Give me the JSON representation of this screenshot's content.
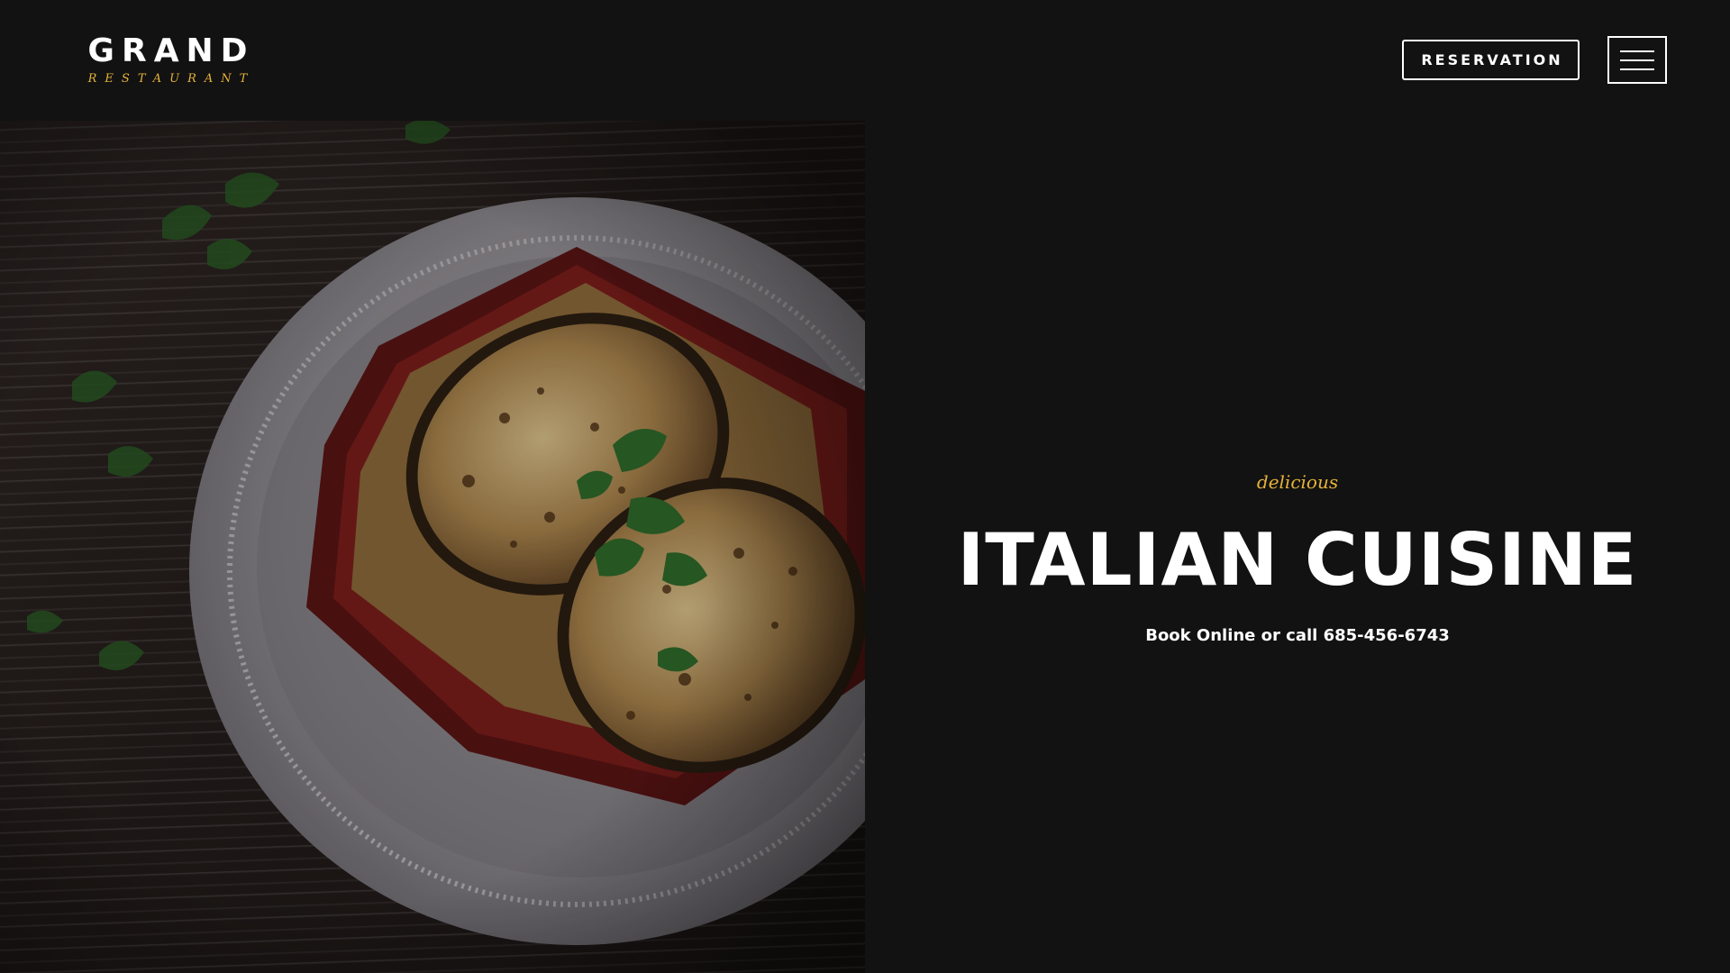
{
  "brand": {
    "name": "GRAND",
    "subtitle": "RESTAURANT"
  },
  "header": {
    "reservation_label": "RESERVATION",
    "menu_icon": "hamburger-menu-icon"
  },
  "hero": {
    "image_subject": "plated-lasagna-photo",
    "tagline": "delicious",
    "title": "ITALIAN CUISINE",
    "subtitle": "Book Online or call 685-456-6743"
  },
  "colors": {
    "background": "#121212",
    "accent": "#e5b23a",
    "text": "#ffffff"
  }
}
